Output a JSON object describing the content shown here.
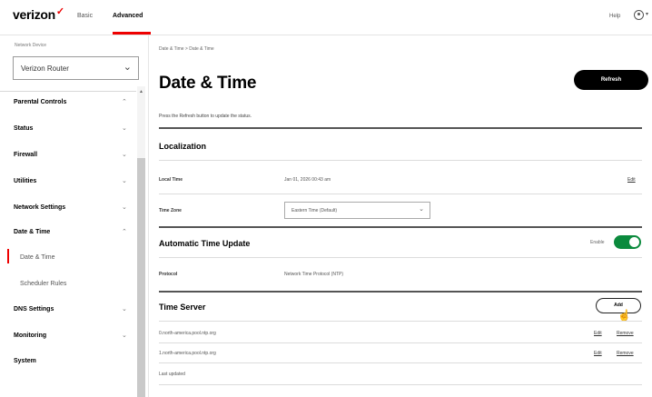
{
  "header": {
    "logo": "verizon",
    "logo_mark": "✓",
    "nav": [
      "Basic",
      "Advanced"
    ],
    "help": "Help"
  },
  "sidebar": {
    "device_label": "Network Device",
    "device_value": "Verizon Router",
    "items": [
      {
        "label": "Parental Controls"
      },
      {
        "label": "Status"
      },
      {
        "label": "Firewall"
      },
      {
        "label": "Utilities"
      },
      {
        "label": "Network Settings"
      },
      {
        "label": "Date & Time"
      },
      {
        "label": "Date & Time"
      },
      {
        "label": "Scheduler Rules"
      },
      {
        "label": "DNS Settings"
      },
      {
        "label": "Monitoring"
      },
      {
        "label": "System"
      }
    ]
  },
  "main": {
    "breadcrumb": "Date & Time  >  Date & Time",
    "title": "Date & Time",
    "refresh_label": "Refresh",
    "hint": "Press the Refresh button to update the status.",
    "localization": {
      "title": "Localization",
      "local_time_label": "Local Time",
      "local_time_value": "Jan 01, 2026 00:43 am",
      "edit": "Edit",
      "time_zone_label": "Time Zone",
      "time_zone_value": "Eastern Time (Default)"
    },
    "auto_update": {
      "title": "Automatic Time Update",
      "enable_label": "Enable",
      "enabled": true,
      "protocol_label": "Protocol",
      "protocol_value": "Network Time Protocol (NTP)"
    },
    "time_server": {
      "title": "Time Server",
      "add_label": "Add",
      "servers": [
        {
          "host": "0.north-america.pool.ntp.org",
          "edit": "Edit",
          "remove": "Remove"
        },
        {
          "host": "1.north-america.pool.ntp.org",
          "edit": "Edit",
          "remove": "Remove"
        }
      ],
      "last_updated": "Last updated"
    }
  }
}
